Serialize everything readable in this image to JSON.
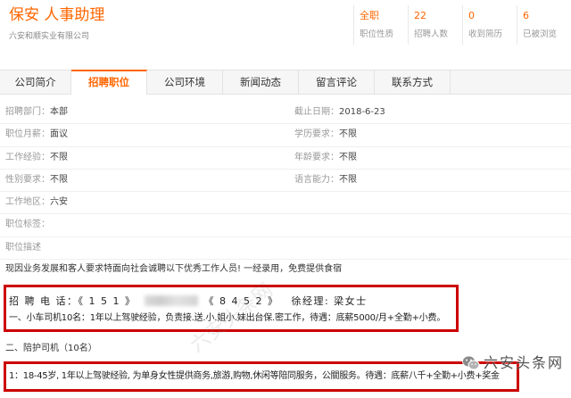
{
  "header": {
    "title": "保安 人事助理",
    "company": "六安和顺实业有限公司",
    "stats": [
      {
        "value": "全职",
        "label": "职位性质"
      },
      {
        "value": "22",
        "label": "招聘人数"
      },
      {
        "value": "0",
        "label": "收到简历"
      },
      {
        "value": "6",
        "label": "已被浏览"
      }
    ]
  },
  "tabs": [
    {
      "label": "公司简介",
      "active": false
    },
    {
      "label": "招聘职位",
      "active": true
    },
    {
      "label": "公司环境",
      "active": false
    },
    {
      "label": "新闻动态",
      "active": false
    },
    {
      "label": "留言评论",
      "active": false
    },
    {
      "label": "联系方式",
      "active": false
    }
  ],
  "details": {
    "department": {
      "label": "招聘部门：",
      "value": "本部"
    },
    "deadline": {
      "label": "截止日期：",
      "value": "2018-6-23"
    },
    "salary": {
      "label": "职位月薪：",
      "value": "面议"
    },
    "education": {
      "label": "学历要求：",
      "value": "不限"
    },
    "experience": {
      "label": "工作经验：",
      "value": "不限"
    },
    "age": {
      "label": "年龄要求：",
      "value": "不限"
    },
    "gender": {
      "label": "性别要求：",
      "value": "不限"
    },
    "language": {
      "label": "语言能力：",
      "value": "不限"
    },
    "location": {
      "label": "工作地区：",
      "value": "六安"
    },
    "tags": {
      "label": "职位标签："
    },
    "description_label": "职位描述"
  },
  "description": {
    "intro": "现因业务发展和客人要求特面向社会诚聘以下优秀工作人员! 一经录用，免费提供食宿",
    "contact": {
      "label": "招 聘 电 话：",
      "phone_prefix": "《 1 5 1 》",
      "phone_suffix": "《 8 4 5 2 》",
      "persons": "徐经理: 梁女士"
    },
    "position1": "一、小车司机10名：1年以上驾驶经验，负责接.送.小.姐小.妹出台保.密工作，待遇：底薪5000/月+全勤+小费。",
    "position2_title": "二、陪护司机（10名）",
    "position2_detail": "1：18-45岁, 1年以上驾驶经验, 为单身女性提供商务,旅游,购物,休闲等陪同服务，公關服务。待遇：底薪八千+全勤+小费+奖金"
  },
  "watermark": {
    "text": "六安头条网",
    "diagonal_text": "六安头条网",
    "icon": "wechat-icon"
  },
  "colors": {
    "accent": "#ff6600",
    "highlight_border": "#cc0000",
    "label": "#999999",
    "text": "#333333"
  }
}
